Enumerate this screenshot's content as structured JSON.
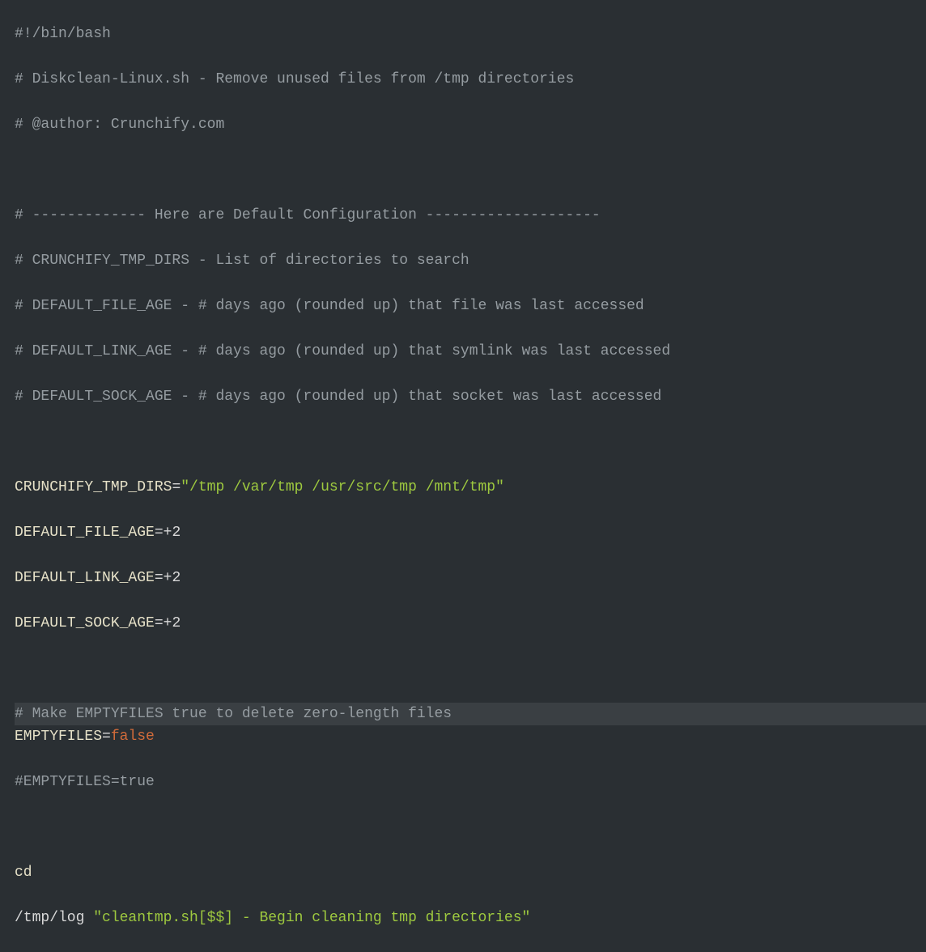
{
  "code": {
    "l1_shebang": "#!/bin/bash",
    "l2_comment": "# Diskclean-Linux.sh - Remove unused files from /tmp directories",
    "l3_comment": "# @author: Crunchify.com",
    "l5_comment": "# ------------- Here are Default Configuration --------------------",
    "l6_comment": "# CRUNCHIFY_TMP_DIRS - List of directories to search",
    "l7_comment": "# DEFAULT_FILE_AGE - # days ago (rounded up) that file was last accessed",
    "l8_comment": "# DEFAULT_LINK_AGE - # days ago (rounded up) that symlink was last accessed",
    "l9_comment": "# DEFAULT_SOCK_AGE - # days ago (rounded up) that socket was last accessed",
    "l11_var": "CRUNCHIFY_TMP_DIRS",
    "l11_eq": "=",
    "l11_val": "\"/tmp /var/tmp /usr/src/tmp /mnt/tmp\"",
    "l12_var": "DEFAULT_FILE_AGE",
    "l12_eq": "=",
    "l12_val": "+2",
    "l13_var": "DEFAULT_LINK_AGE",
    "l13_eq": "=",
    "l13_val": "+2",
    "l14_var": "DEFAULT_SOCK_AGE",
    "l14_eq": "=",
    "l14_val": "+2",
    "l16_comment": "# Make EMPTYFILES true to delete zero-length files",
    "l17_var": "EMPTYFILES",
    "l17_eq": "=",
    "l17_val": "false",
    "l18_comment": "#EMPTYFILES=true",
    "l20_cmd": "cd",
    "l21_path": "/tmp/log ",
    "l21_str": "\"cleantmp.sh[$$] - Begin cleaning tmp directories\""
  }
}
